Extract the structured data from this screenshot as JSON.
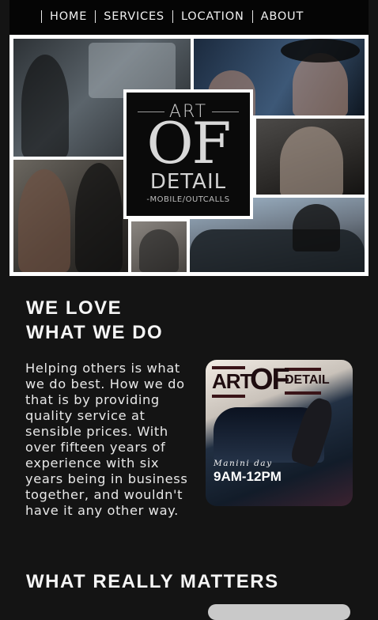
{
  "nav": {
    "items": [
      "HOME",
      "SERVICES",
      "LOCATION",
      "ABOUT"
    ]
  },
  "hero": {
    "logo": {
      "art": "ART",
      "of": "OF",
      "detail": "DETAIL",
      "subtitle": "-MOBILE/OUTCALLS"
    }
  },
  "about": {
    "heading_line1": "WE LOVE",
    "heading_line2": "WHAT WE DO",
    "paragraph": "Helping others is what we do best. How we do that is by providing quality service at sensible prices. With over fifteen years of experience with six years being in business together, and wouldn't have it any other way."
  },
  "promo": {
    "art": "ART",
    "of": "OF",
    "detail": "DETAIL",
    "day": "Manini day",
    "time": "9AM-12PM"
  },
  "matters": {
    "heading": "WHAT REALLY MATTERS"
  },
  "colors": {
    "background": "#141414",
    "nav_bar": "#050505",
    "text": "#f2f2f2"
  }
}
